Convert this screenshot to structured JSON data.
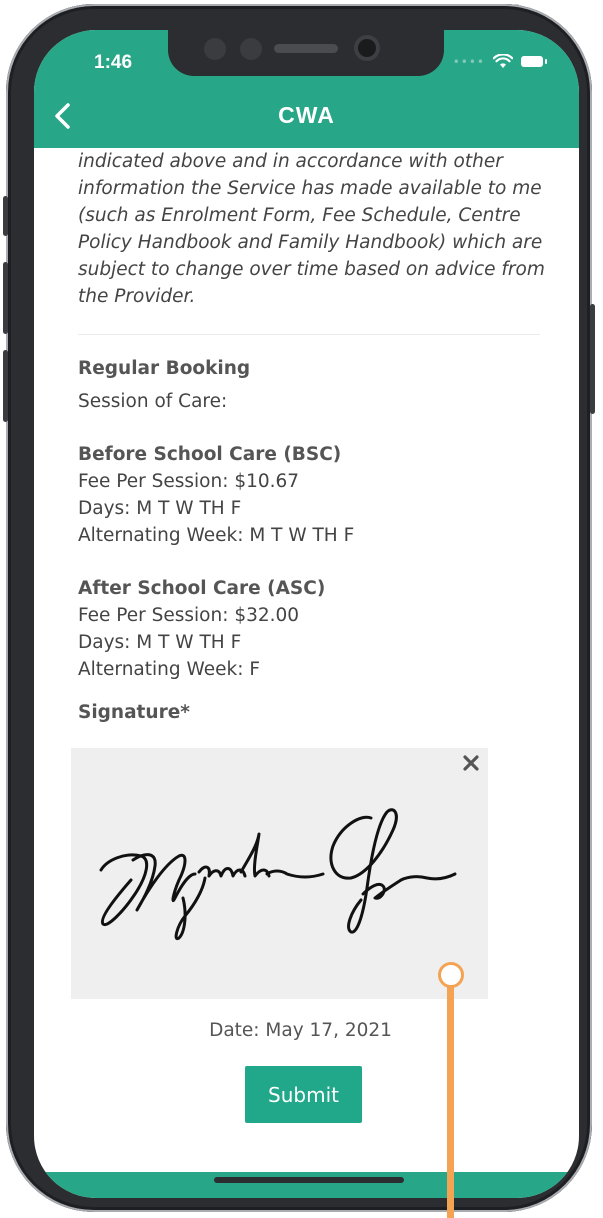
{
  "status_bar": {
    "time": "1:46"
  },
  "nav": {
    "title": "CWA"
  },
  "agreement_text": "indicated above and in accordance with other information the Service has made available to me (such as Enrolment Form, Fee Schedule, Centre Policy Handbook and Family Handbook) which are subject to change over time based on advice from the Provider.",
  "booking": {
    "heading": "Regular Booking",
    "session_label": "Session of Care:",
    "sessions": [
      {
        "name": "Before School Care (BSC)",
        "fee": "Fee Per Session: $10.67",
        "days": "Days: M T W TH F",
        "alternating": "Alternating Week: M T W TH F"
      },
      {
        "name": "After School Care (ASC)",
        "fee": "Fee Per Session: $32.00",
        "days": "Days: M T W TH F",
        "alternating": "Alternating Week: F"
      }
    ]
  },
  "signature": {
    "label": "Signature*"
  },
  "date_text": "Date: May 17, 2021",
  "submit_label": "Submit",
  "colors": {
    "brand": "#28a688",
    "button": "#21a88a",
    "annotation": "#f4a352",
    "signature_bg": "#efefef"
  }
}
